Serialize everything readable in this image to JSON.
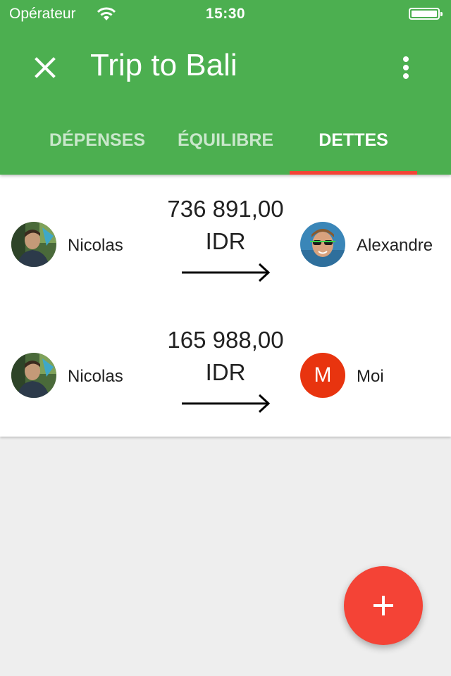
{
  "status_bar": {
    "carrier": "Opérateur",
    "time": "15:30",
    "wifi_icon": "wifi-icon",
    "battery_icon": "battery-full-icon"
  },
  "header": {
    "title": "Trip to Bali",
    "close_icon": "close-icon",
    "more_icon": "more-vertical-icon"
  },
  "tabs": [
    {
      "label": "DÉPENSES",
      "active": false
    },
    {
      "label": "ÉQUILIBRE",
      "active": false
    },
    {
      "label": "DETTES",
      "active": true
    }
  ],
  "debts": [
    {
      "from": "Nicolas",
      "amount": "736 891,00",
      "currency": "IDR",
      "to": "Alexandre"
    },
    {
      "from": "Nicolas",
      "amount": "165 988,00",
      "currency": "IDR",
      "to": "Moi",
      "to_initial": "M"
    }
  ],
  "fab": {
    "icon": "plus-icon"
  },
  "colors": {
    "primary": "#4caf50",
    "accent": "#f44336",
    "tab_indicator": "#f44336",
    "avatar_moi": "#e8340f"
  }
}
